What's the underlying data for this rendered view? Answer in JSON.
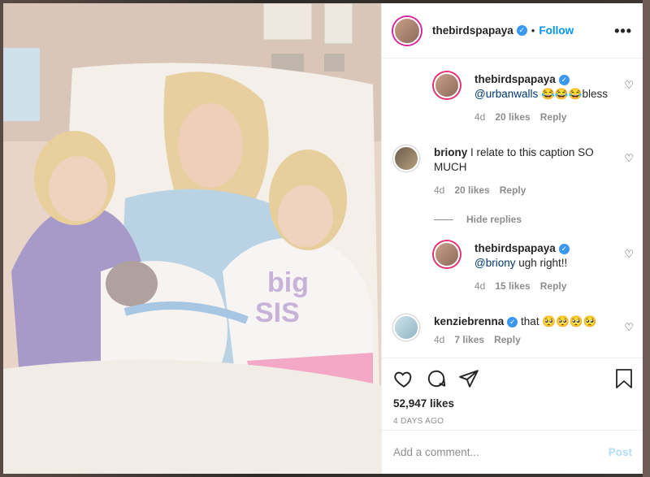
{
  "colors": {
    "accent": "#0095f6",
    "verified": "#3897f0",
    "text": "#262626",
    "muted": "#8e8e8e",
    "post_disabled": "#b2dffc"
  },
  "header": {
    "username": "thebirdspapaya",
    "verified_icon": "verified-badge-icon",
    "dot": "•",
    "follow_label": "Follow",
    "more_icon": "more-options-icon",
    "more_label": "•••"
  },
  "comments": [
    {
      "user": "thebirdspapaya",
      "verified": true,
      "mention": "@urbanwalls",
      "text": "😂😂😂bless",
      "age": "4d",
      "likes": "20 likes",
      "reply": "Reply"
    },
    {
      "user": "briony",
      "verified": false,
      "text": "I relate to this caption SO MUCH",
      "age": "4d",
      "likes": "20 likes",
      "reply": "Reply"
    },
    {
      "hide_replies": "Hide replies"
    },
    {
      "user": "thebirdspapaya",
      "verified": true,
      "mention": "@briony",
      "text": " ugh right!!",
      "age": "4d",
      "likes": "15 likes",
      "reply": "Reply"
    },
    {
      "user": "kenziebrenna",
      "verified": true,
      "text": "that 🥺🥺🥺🥺",
      "age": "4d",
      "likes": "7 likes",
      "reply": "Reply"
    }
  ],
  "actions": {
    "like_icon": "heart-outline-icon",
    "comment_icon": "comment-bubble-icon",
    "share_icon": "paper-plane-icon",
    "save_icon": "bookmark-icon",
    "likes": "52,947 likes",
    "posted": "4 DAYS AGO"
  },
  "add_comment": {
    "placeholder": "Add a comment...",
    "post_label": "Post"
  }
}
